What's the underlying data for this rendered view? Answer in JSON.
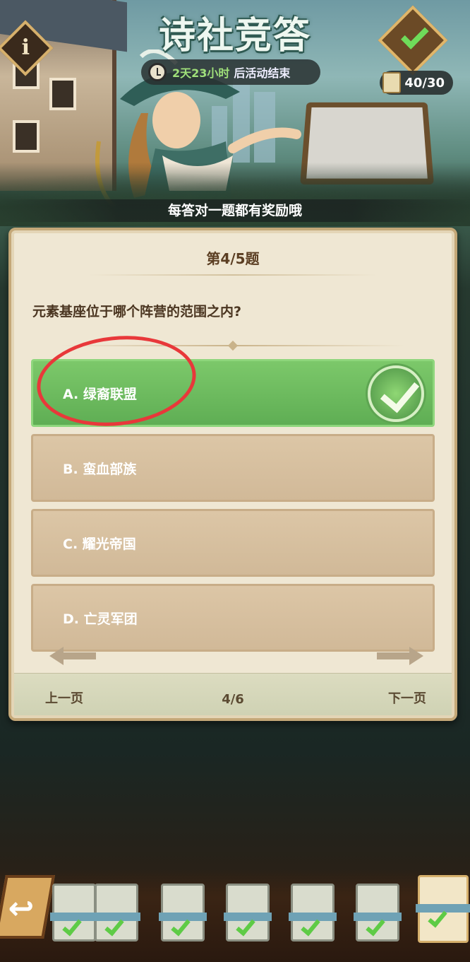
{
  "header": {
    "title": "诗社竞答",
    "timer_highlight": "2天23小时",
    "timer_suffix": "后活动结束",
    "info_label": "i",
    "counter": "40/30"
  },
  "banner": "每答对一题都有奖励哦",
  "quiz": {
    "progress": "第4/5题",
    "question": "元素基座位于哪个阵营的范围之内?",
    "options": [
      {
        "label": "A. 绿裔联盟",
        "state": "correct"
      },
      {
        "label": "B. 蛮血部族",
        "state": "default"
      },
      {
        "label": "C. 耀光帝国",
        "state": "default"
      },
      {
        "label": "D. 亡灵军团",
        "state": "default"
      }
    ]
  },
  "nav": {
    "prev": "上一页",
    "page": "4/6",
    "next": "下一页"
  },
  "colors": {
    "correct_green": "#6cbc5c",
    "annotation_red": "#e8383a",
    "panel_bg": "#efe7d3"
  }
}
